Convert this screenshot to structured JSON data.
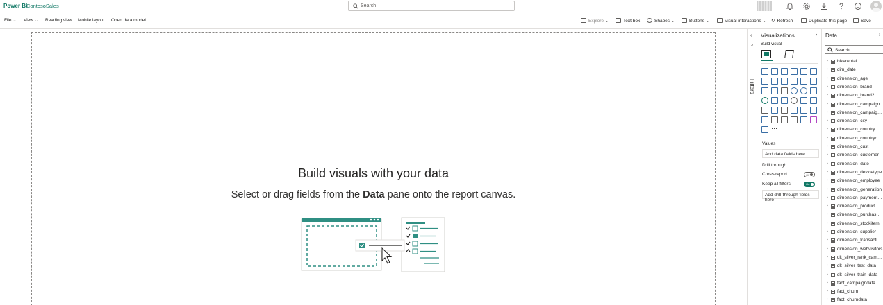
{
  "app": {
    "brand": "Power BI",
    "report_name": "ContosoSales"
  },
  "search": {
    "placeholder": "Search"
  },
  "ribbon": {
    "file": "File",
    "view": "View",
    "reading_view": "Reading view",
    "mobile_layout": "Mobile layout",
    "open_data_model": "Open data model",
    "explore": "Explore",
    "text_box": "Text box",
    "shapes": "Shapes",
    "buttons": "Buttons",
    "visual_interactions": "Visual interactions",
    "refresh": "Refresh",
    "duplicate_page": "Duplicate this page",
    "save": "Save"
  },
  "canvas": {
    "title": "Build visuals with your data",
    "sub_before": "Select or drag fields from the ",
    "sub_bold": "Data",
    "sub_after": " pane onto the report canvas."
  },
  "filters": {
    "label": "Filters"
  },
  "visualizations": {
    "title": "Visualizations",
    "build_visual": "Build visual",
    "values_label": "Values",
    "values_placeholder": "Add data fields here",
    "drill_through": "Drill through",
    "cross_report": "Cross-report",
    "cross_report_state": "Off",
    "keep_all_filters": "Keep all filters",
    "keep_all_filters_state": "On",
    "drill_placeholder": "Add drill-through fields here",
    "more": "···"
  },
  "data_pane": {
    "title": "Data",
    "search_placeholder": "Search",
    "tables": [
      "bikerental",
      "dim_date",
      "dimension_age",
      "dimension_brand",
      "dimension_brand2",
      "dimension_campaign",
      "dimension_campaignse...",
      "dimension_city",
      "dimension_country",
      "dimension_countrydata",
      "dimension_cust",
      "dimension_customer",
      "dimension_date",
      "dimension_devicetype",
      "dimension_employee",
      "dimension_generation",
      "dimension_paymentme...",
      "dimension_product",
      "dimension_purchasese...",
      "dimension_stockitem",
      "dimension_supplier",
      "dimension_transactiont...",
      "dimension_webvisitors",
      "dlt_silver_rank_campaign",
      "dlt_silver_test_data",
      "dlt_silver_train_data",
      "fact_campaigndata",
      "fact_churn",
      "fact_churndata"
    ]
  }
}
